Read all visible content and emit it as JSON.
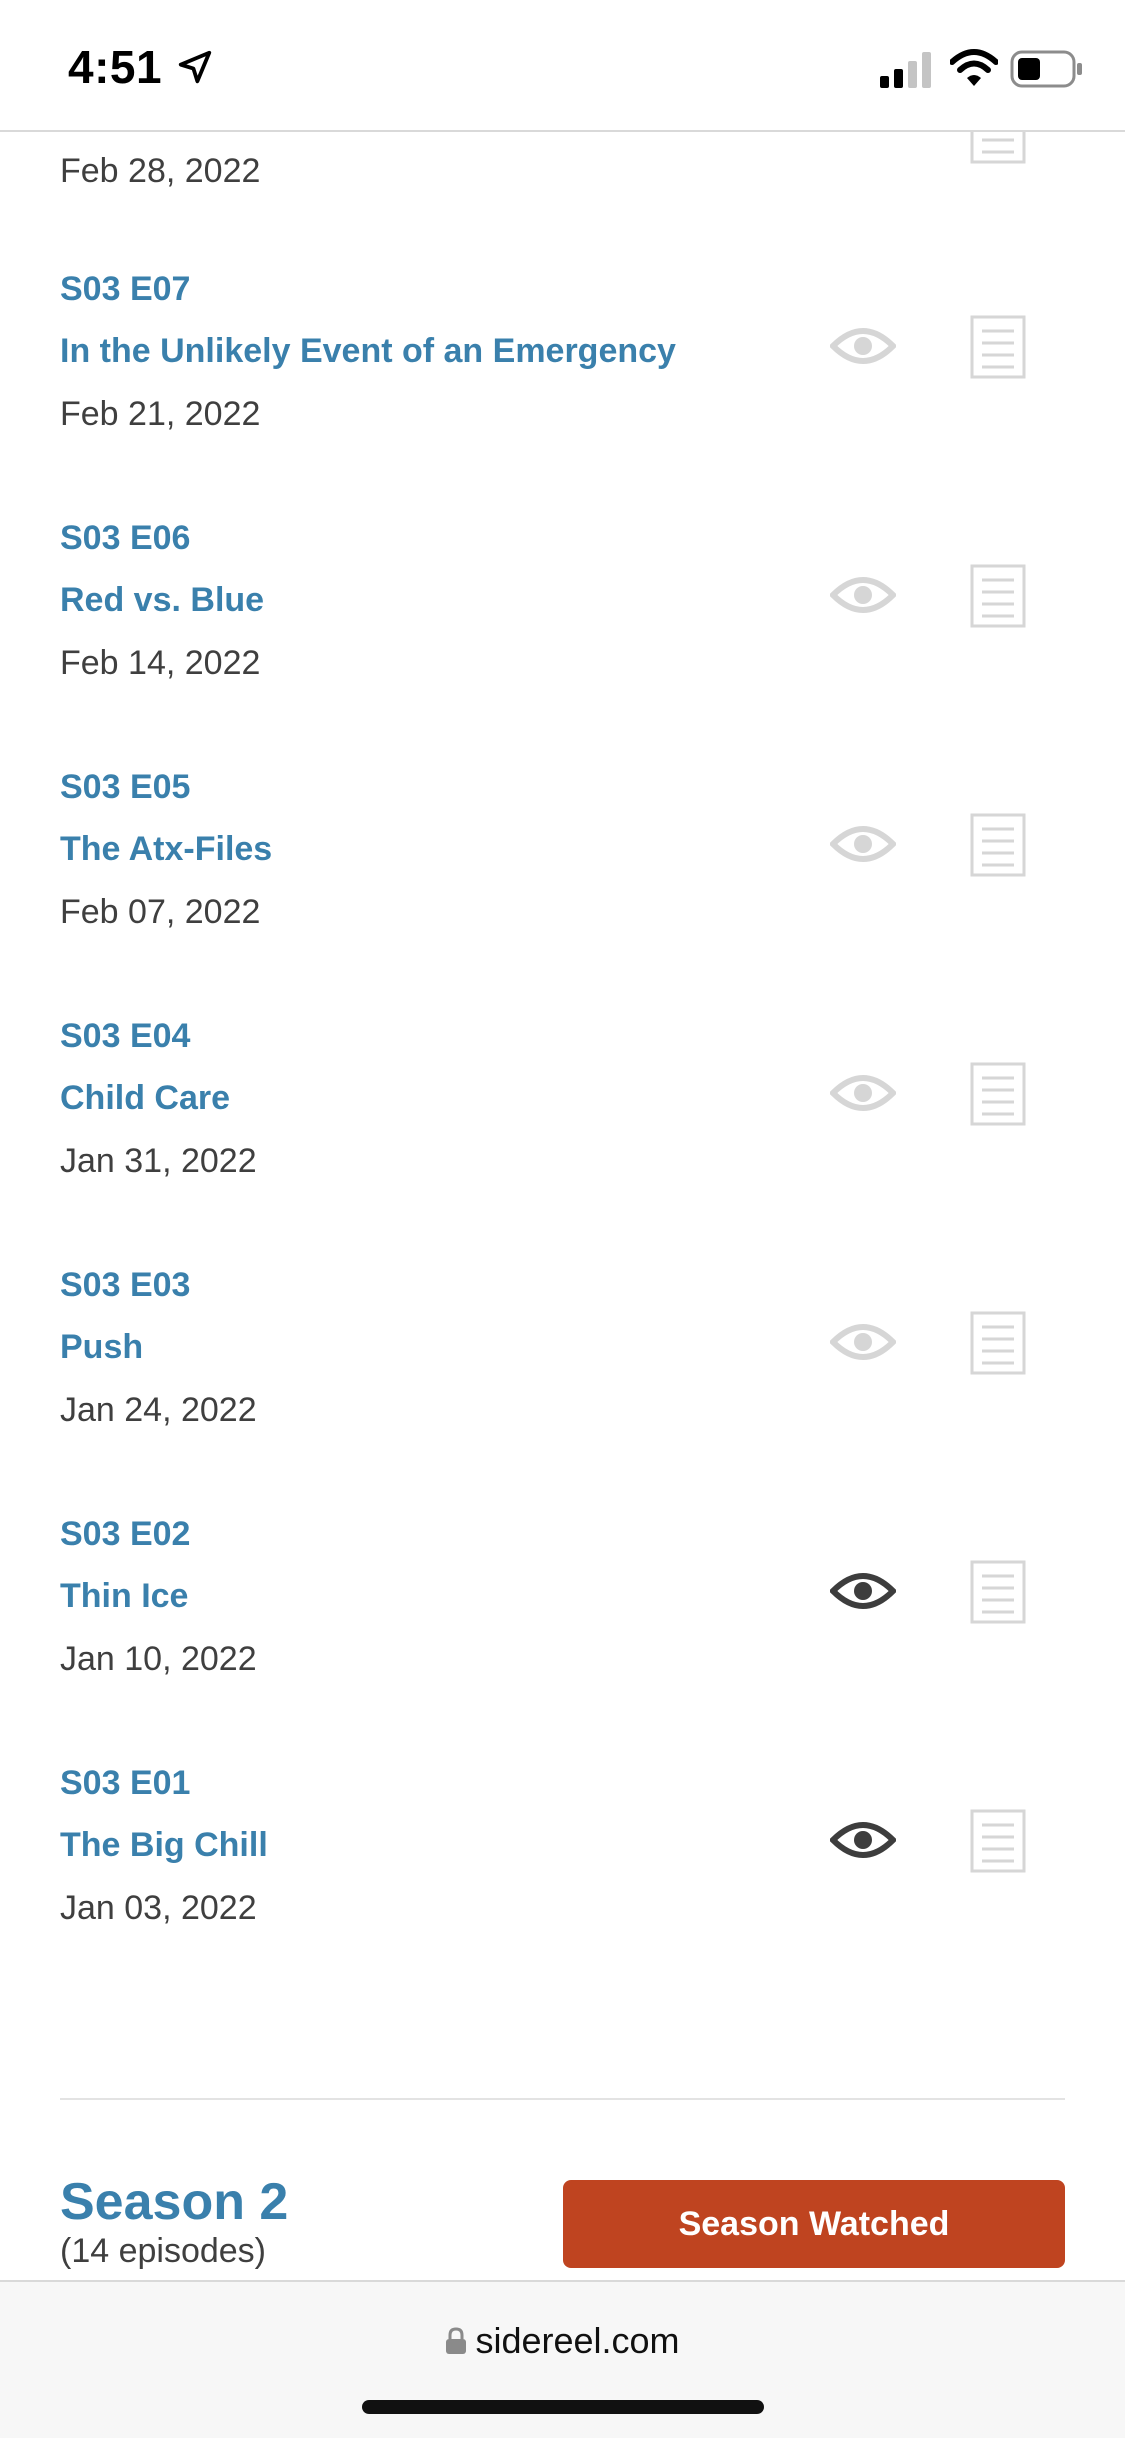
{
  "status_bar": {
    "time": "4:51"
  },
  "partial_episode": {
    "date": "Feb 28, 2022"
  },
  "episodes": [
    {
      "code": "S03 E07",
      "title": "In the Unlikely Event of an Emergency",
      "date": "Feb 21, 2022",
      "watched": false
    },
    {
      "code": "S03 E06",
      "title": "Red vs. Blue",
      "date": "Feb 14, 2022",
      "watched": false
    },
    {
      "code": "S03 E05",
      "title": "The Atx-Files",
      "date": "Feb 07, 2022",
      "watched": false
    },
    {
      "code": "S03 E04",
      "title": "Child Care",
      "date": "Jan 31, 2022",
      "watched": false
    },
    {
      "code": "S03 E03",
      "title": "Push",
      "date": "Jan 24, 2022",
      "watched": false
    },
    {
      "code": "S03 E02",
      "title": "Thin Ice",
      "date": "Jan 10, 2022",
      "watched": true
    },
    {
      "code": "S03 E01",
      "title": "The Big Chill",
      "date": "Jan 03, 2022",
      "watched": true
    }
  ],
  "season_header": {
    "title": "Season 2",
    "episode_count": "(14 episodes)",
    "button_label": "Season Watched"
  },
  "browser": {
    "url": "sidereel.com"
  },
  "colors": {
    "link_blue": "#3a80ac",
    "button_orange": "#bf4420",
    "watched_icon": "#3d3d3d",
    "unwatched_icon": "#d6d6d6"
  },
  "icons": {
    "watched": "eye-icon",
    "notes": "notes-icon"
  }
}
